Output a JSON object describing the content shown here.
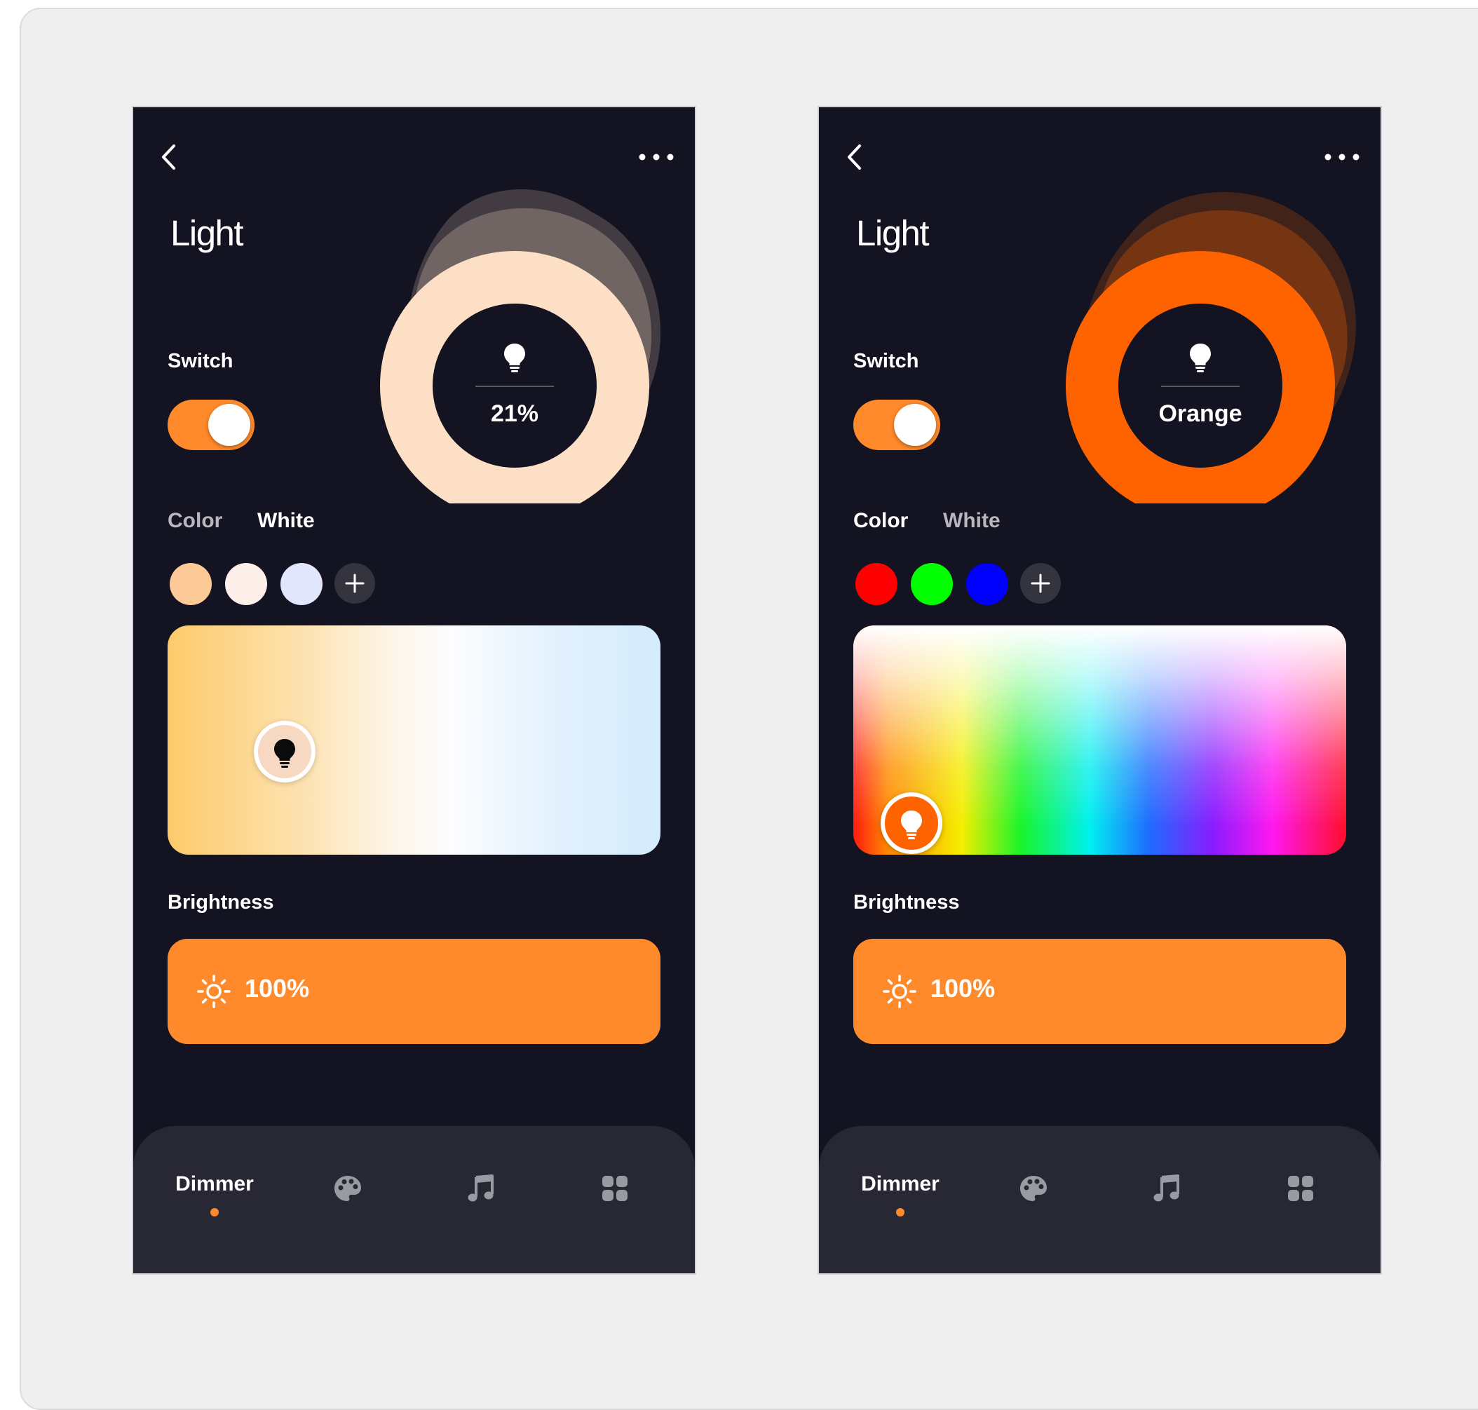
{
  "screens": [
    {
      "title": "Light",
      "switch_label": "Switch",
      "switch_on": true,
      "dial_value": "21%",
      "dial_color": "#fddfc6",
      "tabs": [
        {
          "label": "Color",
          "active": false
        },
        {
          "label": "White",
          "active": true
        }
      ],
      "swatches": [
        "#fdca97",
        "#fdefe9",
        "#e1e6fd"
      ],
      "picker_mode": "white",
      "brightness_label": "Brightness",
      "brightness_value": "100%",
      "nav": {
        "active_label": "Dimmer",
        "icons": [
          "palette-icon",
          "music-note-icon",
          "grid-icon"
        ]
      }
    },
    {
      "title": "Light",
      "switch_label": "Switch",
      "switch_on": true,
      "dial_value": "Orange",
      "dial_color": "#ff6300",
      "tabs": [
        {
          "label": "Color",
          "active": true
        },
        {
          "label": "White",
          "active": false
        }
      ],
      "swatches": [
        "#ff0000",
        "#00ff00",
        "#0000ff"
      ],
      "picker_mode": "color",
      "brightness_label": "Brightness",
      "brightness_value": "100%",
      "nav": {
        "active_label": "Dimmer",
        "icons": [
          "palette-icon",
          "music-note-icon",
          "grid-icon"
        ]
      }
    }
  ],
  "colors": {
    "background": "#131321",
    "accent": "#fe8a2b",
    "nav_background": "#282835",
    "tab_active": "#ffffff",
    "tab_inactive": "#b7b7bd"
  }
}
